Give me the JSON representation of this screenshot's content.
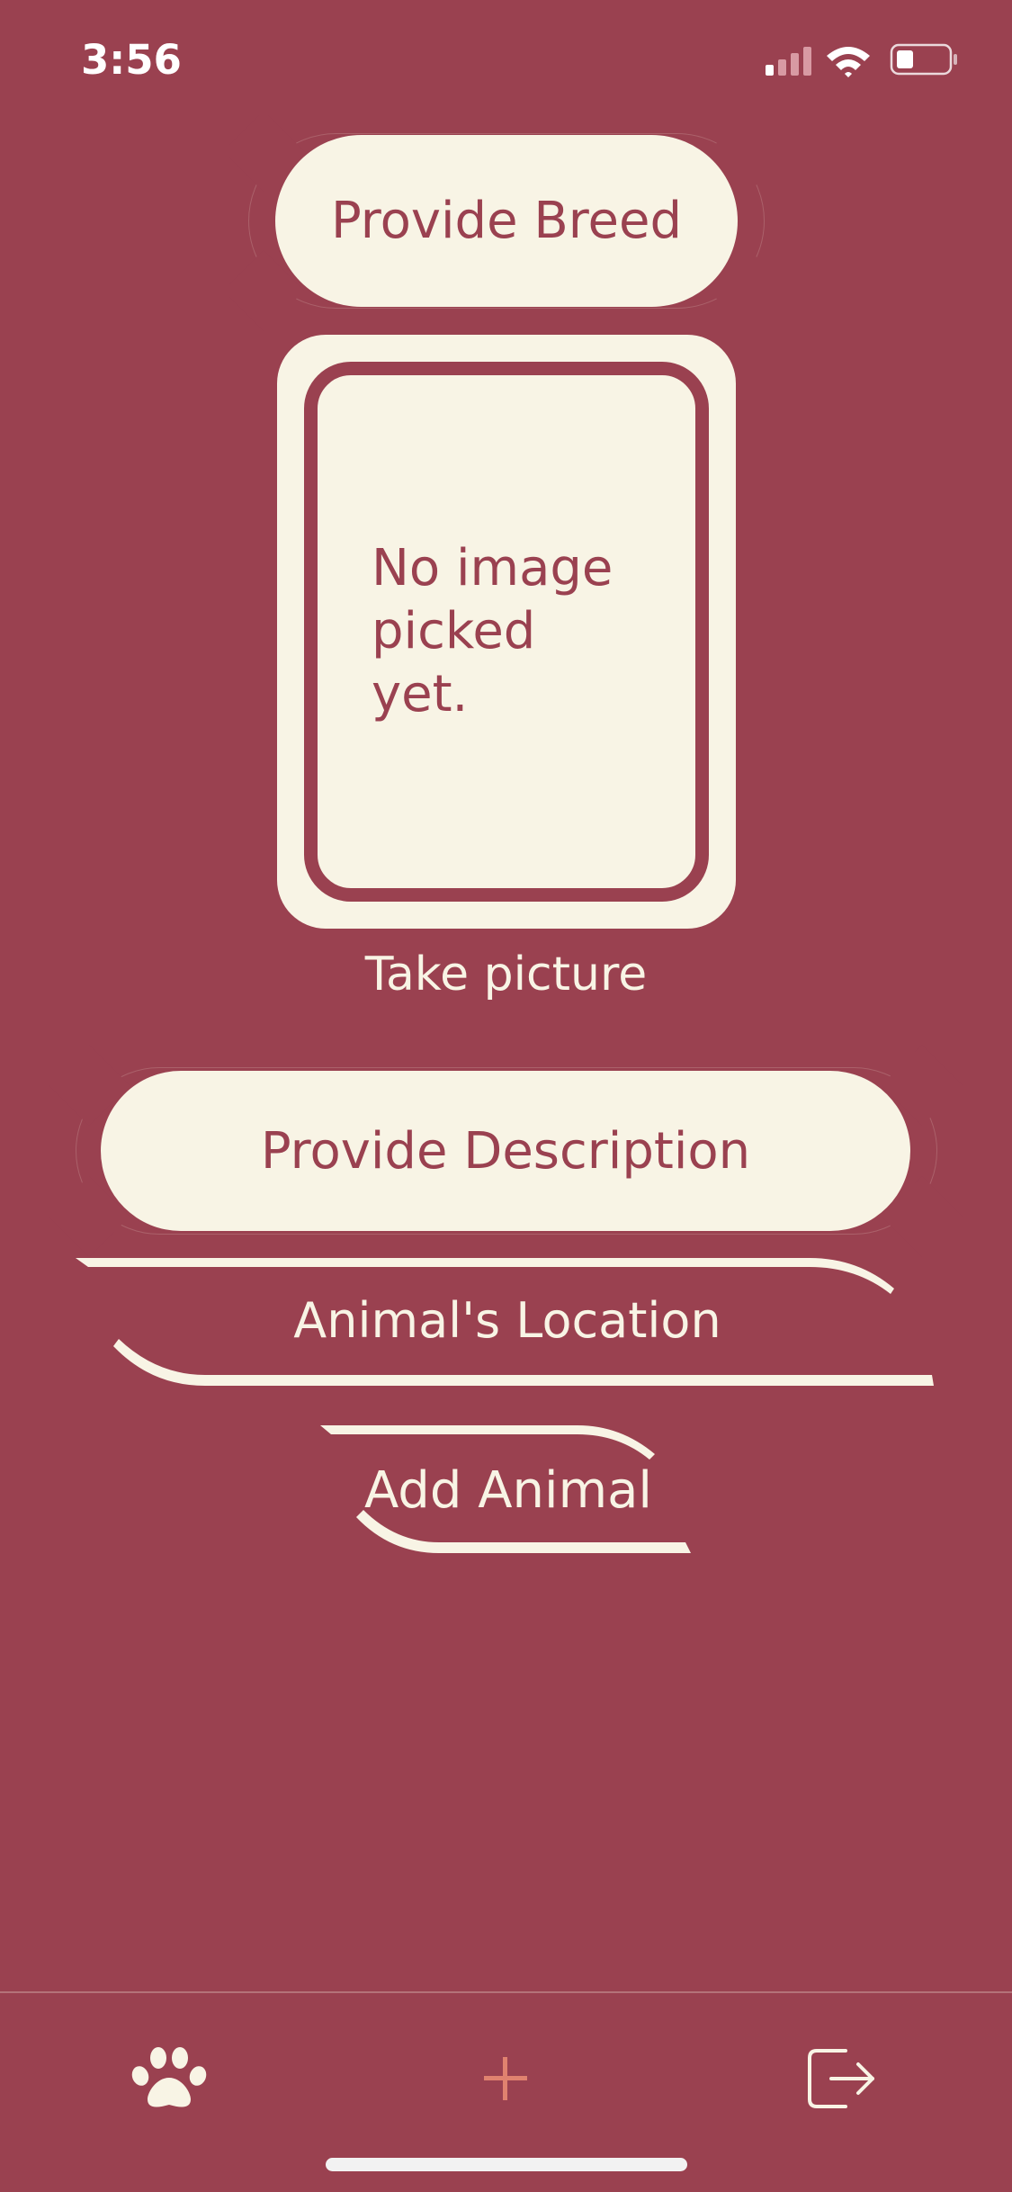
{
  "status_bar": {
    "time": "3:56",
    "signal_icon": "cellular-signal-icon",
    "wifi_icon": "wifi-icon",
    "battery_icon": "battery-icon"
  },
  "form": {
    "breed_button": "Provide Breed",
    "image_placeholder": "No image picked yet.",
    "take_picture": "Take picture",
    "description_button": "Provide Description",
    "location_button": "Animal's Location",
    "add_button": "Add Animal"
  },
  "tab_bar": {
    "items": [
      {
        "icon": "paw-icon",
        "active": true
      },
      {
        "icon": "plus-icon",
        "active": false
      },
      {
        "icon": "logout-icon",
        "active": false
      }
    ]
  },
  "colors": {
    "background": "#9a4150",
    "cream": "#f8f4e5",
    "accent": "#e0826f"
  }
}
